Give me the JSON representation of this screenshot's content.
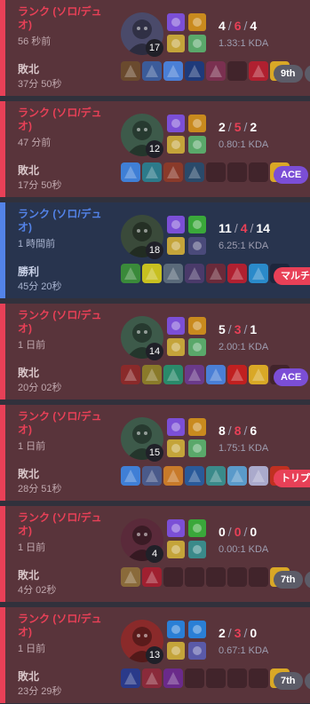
{
  "matches": [
    {
      "queue": "ランク (ソロ/デュオ)",
      "time_ago": "56 秒前",
      "result": "敗北",
      "duration": "37分 50秒",
      "win": false,
      "champion_level": "17",
      "champion_color": "#4a4a6a",
      "spells": [
        "#7b4fd6",
        "#c98a1e",
        "#c4a43a",
        "#5aa86a"
      ],
      "spell_icons": [
        "flash-icon",
        "ignite-icon",
        "teleport-icon",
        "barrier-icon"
      ],
      "kills": "4",
      "deaths": "6",
      "assists": "4",
      "kda": "1.33:1 KDA",
      "items": [
        "#6a4a2e",
        "#3b5b9a",
        "#4a7fd6",
        "#1f3a7a",
        "#7a3050",
        "",
        "#b02030",
        "#d9a826"
      ],
      "badge": "9th",
      "badge_type": "rank",
      "show_more": true
    },
    {
      "queue": "ランク (ソロ/デュオ)",
      "time_ago": "47 分前",
      "result": "敗北",
      "duration": "17分 50秒",
      "win": false,
      "champion_level": "12",
      "champion_color": "#3d5a4a",
      "spells": [
        "#7b4fd6",
        "#c98a1e",
        "#c4a43a",
        "#5aa86a"
      ],
      "spell_icons": [
        "flash-icon",
        "ignite-icon",
        "teleport-icon",
        "barrier-icon"
      ],
      "kills": "2",
      "deaths": "5",
      "assists": "2",
      "kda": "0.80:1 KDA",
      "items": [
        "#3f7fd6",
        "#2c7a8a",
        "#8a3a2a",
        "#2a4a6a",
        "",
        "",
        "",
        "#d9a826"
      ],
      "badge": "ACE",
      "badge_type": "ace",
      "show_more": false
    },
    {
      "queue": "ランク (ソロ/デュオ)",
      "time_ago": "1 時間前",
      "result": "勝利",
      "duration": "45分 20秒",
      "win": true,
      "champion_level": "18",
      "champion_color": "#3a4a3a",
      "spells": [
        "#7b4fd6",
        "#3aa83a",
        "#c4a43a",
        "#4a4a7a"
      ],
      "spell_icons": [
        "flash-icon",
        "precision-icon",
        "teleport-icon",
        "domination-icon"
      ],
      "kills": "11",
      "deaths": "4",
      "assists": "14",
      "kda": "6.25:1 KDA",
      "items": [
        "#3a8a3a",
        "#c8c020",
        "#5a6a7a",
        "#4a3a6a",
        "#6a2a3a",
        "#b02030",
        "#2a8aca",
        ""
      ],
      "badge": "マルチキル",
      "badge_type": "multi",
      "show_more": false
    },
    {
      "queue": "ランク (ソロ/デュオ)",
      "time_ago": "1 日前",
      "result": "敗北",
      "duration": "20分 02秒",
      "win": false,
      "champion_level": "14",
      "champion_color": "#3d5a4a",
      "spells": [
        "#7b4fd6",
        "#c98a1e",
        "#c4a43a",
        "#5aa86a"
      ],
      "spell_icons": [
        "flash-icon",
        "ignite-icon",
        "teleport-icon",
        "barrier-icon"
      ],
      "kills": "5",
      "deaths": "3",
      "assists": "1",
      "kda": "2.00:1 KDA",
      "items": [
        "#8a2a2a",
        "#8a7a2a",
        "#2a8a6a",
        "#6a3a8a",
        "#4a7fd6",
        "#c02020",
        "#d9a826",
        ""
      ],
      "badge": "ACE",
      "badge_type": "ace",
      "show_more": false
    },
    {
      "queue": "ランク (ソロ/デュオ)",
      "time_ago": "1 日前",
      "result": "敗北",
      "duration": "28分 51秒",
      "win": false,
      "champion_level": "15",
      "champion_color": "#3d5a4a",
      "spells": [
        "#7b4fd6",
        "#c98a1e",
        "#c4a43a",
        "#5aa86a"
      ],
      "spell_icons": [
        "flash-icon",
        "ignite-icon",
        "teleport-icon",
        "barrier-icon"
      ],
      "kills": "8",
      "deaths": "8",
      "assists": "6",
      "kda": "1.75:1 KDA",
      "items": [
        "#3f7fd6",
        "#4a5a8a",
        "#c87a2a",
        "#2a5a9a",
        "#3a8a8a",
        "#5a9aca",
        "#aaaacc",
        "#c03020"
      ],
      "badge": "トリプルキル",
      "badge_type": "multi",
      "show_more": false
    },
    {
      "queue": "ランク (ソロ/デュオ)",
      "time_ago": "1 日前",
      "result": "敗北",
      "duration": "4分 02秒",
      "win": false,
      "champion_level": "4",
      "champion_color": "#5a2a3a",
      "spells": [
        "#7b4fd6",
        "#3aa83a",
        "#c4a43a",
        "#3a8a8a"
      ],
      "spell_icons": [
        "flash-icon",
        "precision-icon",
        "teleport-icon",
        "resolve-icon"
      ],
      "kills": "0",
      "deaths": "0",
      "assists": "0",
      "kda": "0.00:1 KDA",
      "items": [
        "#8a6a3a",
        "#a02030",
        "",
        "",
        "",
        "",
        "",
        "#d9a826"
      ],
      "badge": "7th",
      "badge_type": "rank",
      "show_more": true
    },
    {
      "queue": "ランク (ソロ/デュオ)",
      "time_ago": "1 日前",
      "result": "敗北",
      "duration": "23分 29秒",
      "win": false,
      "champion_level": "13",
      "champion_color": "#8a2a2a",
      "spells": [
        "#2a7fd6",
        "#2a7fd6",
        "#c4a43a",
        "#5a5aa8"
      ],
      "spell_icons": [
        "ghost-icon",
        "cleanse-icon",
        "teleport-icon",
        "sorcery-icon"
      ],
      "kills": "2",
      "deaths": "3",
      "assists": "0",
      "kda": "0.67:1 KDA",
      "items": [
        "#2a3a8a",
        "#8a2a3a",
        "#6a2a8a",
        "",
        "",
        "",
        "",
        "#d9a826"
      ],
      "badge": "7th",
      "badge_type": "rank",
      "show_more": true
    }
  ]
}
